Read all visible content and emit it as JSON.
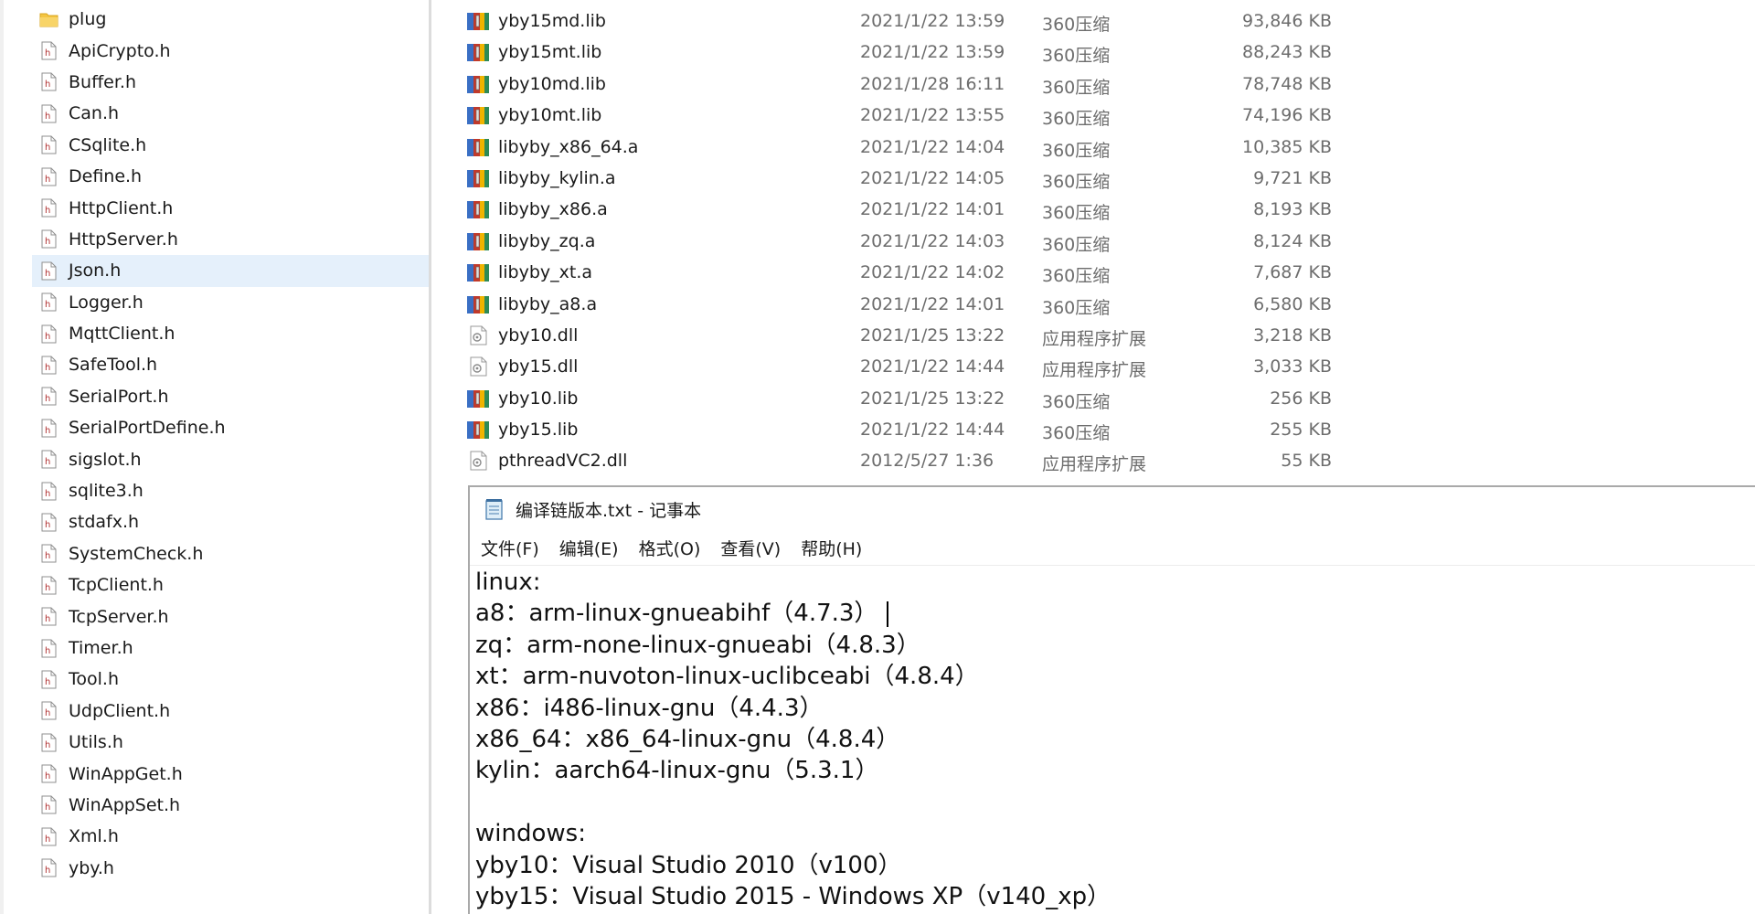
{
  "left_pane": {
    "items": [
      {
        "label": "plug",
        "kind": "folder",
        "selected": false
      },
      {
        "label": "ApiCrypto.h",
        "kind": "header",
        "selected": false
      },
      {
        "label": "Buffer.h",
        "kind": "header",
        "selected": false
      },
      {
        "label": "Can.h",
        "kind": "header",
        "selected": false
      },
      {
        "label": "CSqlite.h",
        "kind": "header",
        "selected": false
      },
      {
        "label": "Define.h",
        "kind": "header",
        "selected": false
      },
      {
        "label": "HttpClient.h",
        "kind": "header",
        "selected": false
      },
      {
        "label": "HttpServer.h",
        "kind": "header",
        "selected": false
      },
      {
        "label": "Json.h",
        "kind": "header",
        "selected": true
      },
      {
        "label": "Logger.h",
        "kind": "header",
        "selected": false
      },
      {
        "label": "MqttClient.h",
        "kind": "header",
        "selected": false
      },
      {
        "label": "SafeTool.h",
        "kind": "header",
        "selected": false
      },
      {
        "label": "SerialPort.h",
        "kind": "header",
        "selected": false
      },
      {
        "label": "SerialPortDefine.h",
        "kind": "header",
        "selected": false
      },
      {
        "label": "sigslot.h",
        "kind": "header",
        "selected": false
      },
      {
        "label": "sqlite3.h",
        "kind": "header",
        "selected": false
      },
      {
        "label": "stdafx.h",
        "kind": "header",
        "selected": false
      },
      {
        "label": "SystemCheck.h",
        "kind": "header",
        "selected": false
      },
      {
        "label": "TcpClient.h",
        "kind": "header",
        "selected": false
      },
      {
        "label": "TcpServer.h",
        "kind": "header",
        "selected": false
      },
      {
        "label": "Timer.h",
        "kind": "header",
        "selected": false
      },
      {
        "label": "Tool.h",
        "kind": "header",
        "selected": false
      },
      {
        "label": "UdpClient.h",
        "kind": "header",
        "selected": false
      },
      {
        "label": "Utils.h",
        "kind": "header",
        "selected": false
      },
      {
        "label": "WinAppGet.h",
        "kind": "header",
        "selected": false
      },
      {
        "label": "WinAppSet.h",
        "kind": "header",
        "selected": false
      },
      {
        "label": "Xml.h",
        "kind": "header",
        "selected": false
      },
      {
        "label": "yby.h",
        "kind": "header",
        "selected": false
      }
    ]
  },
  "file_list": {
    "rows": [
      {
        "name": "yby15md.lib",
        "date": "2021/1/22 13:59",
        "type": "360压缩",
        "size": "93,846 KB",
        "icon": "archive-icon"
      },
      {
        "name": "yby15mt.lib",
        "date": "2021/1/22 13:59",
        "type": "360压缩",
        "size": "88,243 KB",
        "icon": "archive-icon"
      },
      {
        "name": "yby10md.lib",
        "date": "2021/1/28 16:11",
        "type": "360压缩",
        "size": "78,748 KB",
        "icon": "archive-icon"
      },
      {
        "name": "yby10mt.lib",
        "date": "2021/1/22 13:55",
        "type": "360压缩",
        "size": "74,196 KB",
        "icon": "archive-icon"
      },
      {
        "name": "libyby_x86_64.a",
        "date": "2021/1/22 14:04",
        "type": "360压缩",
        "size": "10,385 KB",
        "icon": "archive-icon"
      },
      {
        "name": "libyby_kylin.a",
        "date": "2021/1/22 14:05",
        "type": "360压缩",
        "size": "9,721 KB",
        "icon": "archive-icon"
      },
      {
        "name": "libyby_x86.a",
        "date": "2021/1/22 14:01",
        "type": "360压缩",
        "size": "8,193 KB",
        "icon": "archive-icon"
      },
      {
        "name": "libyby_zq.a",
        "date": "2021/1/22 14:03",
        "type": "360压缩",
        "size": "8,124 KB",
        "icon": "archive-icon"
      },
      {
        "name": "libyby_xt.a",
        "date": "2021/1/22 14:02",
        "type": "360压缩",
        "size": "7,687 KB",
        "icon": "archive-icon"
      },
      {
        "name": "libyby_a8.a",
        "date": "2021/1/22 14:01",
        "type": "360压缩",
        "size": "6,580 KB",
        "icon": "archive-icon"
      },
      {
        "name": "yby10.dll",
        "date": "2021/1/25 13:22",
        "type": "应用程序扩展",
        "size": "3,218 KB",
        "icon": "dll-icon"
      },
      {
        "name": "yby15.dll",
        "date": "2021/1/22 14:44",
        "type": "应用程序扩展",
        "size": "3,033 KB",
        "icon": "dll-icon"
      },
      {
        "name": "yby10.lib",
        "date": "2021/1/25 13:22",
        "type": "360压缩",
        "size": "256 KB",
        "icon": "archive-icon"
      },
      {
        "name": "yby15.lib",
        "date": "2021/1/22 14:44",
        "type": "360压缩",
        "size": "255 KB",
        "icon": "archive-icon"
      },
      {
        "name": "pthreadVC2.dll",
        "date": "2012/5/27 1:36",
        "type": "应用程序扩展",
        "size": "55 KB",
        "icon": "dll-icon"
      }
    ]
  },
  "notepad": {
    "title": "编译链版本.txt - 记事本",
    "menu": [
      "文件(F)",
      "编辑(E)",
      "格式(O)",
      "查看(V)",
      "帮助(H)"
    ],
    "lines": [
      "linux:",
      "a8：arm-linux-gnueabihf（4.7.3）",
      "zq：arm-none-linux-gnueabi（4.8.3）",
      "xt：arm-nuvoton-linux-uclibceabi（4.8.4）",
      "x86：i486-linux-gnu（4.4.3）",
      "x86_64：x86_64-linux-gnu（4.8.4）",
      "kylin：aarch64-linux-gnu（5.3.1）",
      "",
      "windows:",
      "yby10：Visual Studio 2010（v100）",
      "yby15：Visual Studio 2015 - Windows XP（v140_xp）"
    ],
    "caret_line": 1
  },
  "colors": {
    "selection": "#e5f0fb",
    "secondary_text": "#6d6d6d",
    "header_icon_red": "#c0392b",
    "folder_yellow": "#f4c542"
  }
}
